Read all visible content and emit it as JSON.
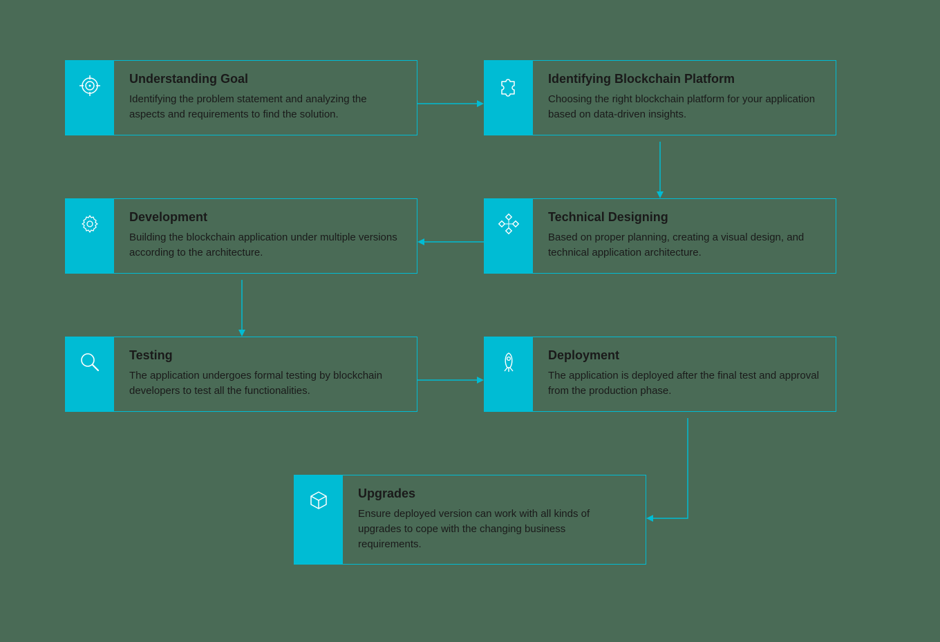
{
  "accent": "#00bcd4",
  "steps": [
    {
      "id": "goal",
      "title": "Understanding Goal",
      "desc": "Identifying the problem statement and analyzing the aspects and requirements to find the solution."
    },
    {
      "id": "platform",
      "title": "Identifying Blockchain Platform",
      "desc": "Choosing the right blockchain platform for your application based on data-driven insights."
    },
    {
      "id": "design",
      "title": "Technical Designing",
      "desc": "Based on proper planning, creating a visual design, and technical application architecture."
    },
    {
      "id": "dev",
      "title": "Development",
      "desc": "Building the blockchain application under multiple versions according to the architecture."
    },
    {
      "id": "test",
      "title": "Testing",
      "desc": "The application undergoes formal testing by blockchain developers to test all the functionalities."
    },
    {
      "id": "deploy",
      "title": "Deployment",
      "desc": "The application is deployed after the final test and approval from the production phase."
    },
    {
      "id": "upgrade",
      "title": "Upgrades",
      "desc": "Ensure deployed version can work with all kinds of upgrades to cope with the changing business requirements."
    }
  ],
  "icons": {
    "goal": "target-icon",
    "platform": "puzzle-icon",
    "design": "nodes-icon",
    "dev": "gear-icon",
    "test": "magnifier-icon",
    "deploy": "rocket-icon",
    "upgrade": "cube-icon"
  }
}
